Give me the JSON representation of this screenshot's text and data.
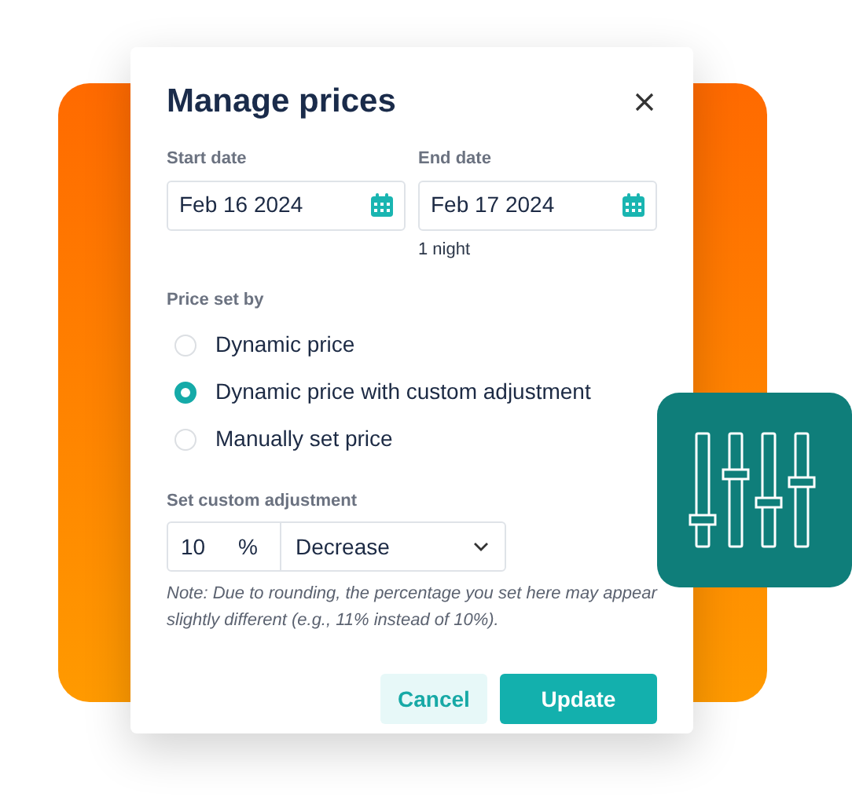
{
  "dialog": {
    "title": "Manage prices"
  },
  "dates": [
    {
      "label": "Start date",
      "value": "Feb 16 2024"
    },
    {
      "label": "End date",
      "value": "Feb 17 2024",
      "hint": "1 night"
    }
  ],
  "price_set_by": {
    "label": "Price set by",
    "options": [
      {
        "label": "Dynamic price",
        "selected": false
      },
      {
        "label": "Dynamic price with custom adjustment",
        "selected": true
      },
      {
        "label": "Manually set price",
        "selected": false
      }
    ]
  },
  "adjustment": {
    "label": "Set custom adjustment",
    "amount": "10",
    "unit": "%",
    "direction": "Decrease",
    "note": "Note: Due to rounding, the percentage you set here may appear slightly different (e.g., 11% instead of 10%)."
  },
  "buttons": [
    {
      "label": "Cancel",
      "kind": "secondary"
    },
    {
      "label": "Update",
      "kind": "primary"
    }
  ]
}
